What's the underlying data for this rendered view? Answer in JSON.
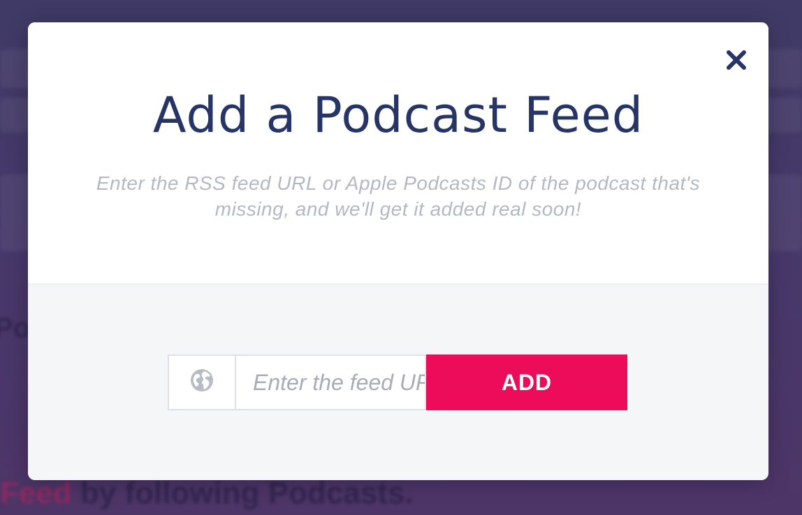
{
  "modal": {
    "title": "Add a Podcast Feed",
    "subtitle": "Enter the RSS feed URL or Apple Podcasts ID of the podcast that's missing, and we'll get it added real soon!",
    "close_icon": "close-icon"
  },
  "form": {
    "globe_icon": "globe-icon",
    "feed_placeholder": "Enter the feed URL or ID",
    "add_label": "ADD"
  },
  "background": {
    "headline_accent": "Feed",
    "headline_rest": " by following Podcasts."
  },
  "colors": {
    "title": "#263566",
    "accent": "#ec0c5a",
    "backdrop": "#47386a"
  }
}
